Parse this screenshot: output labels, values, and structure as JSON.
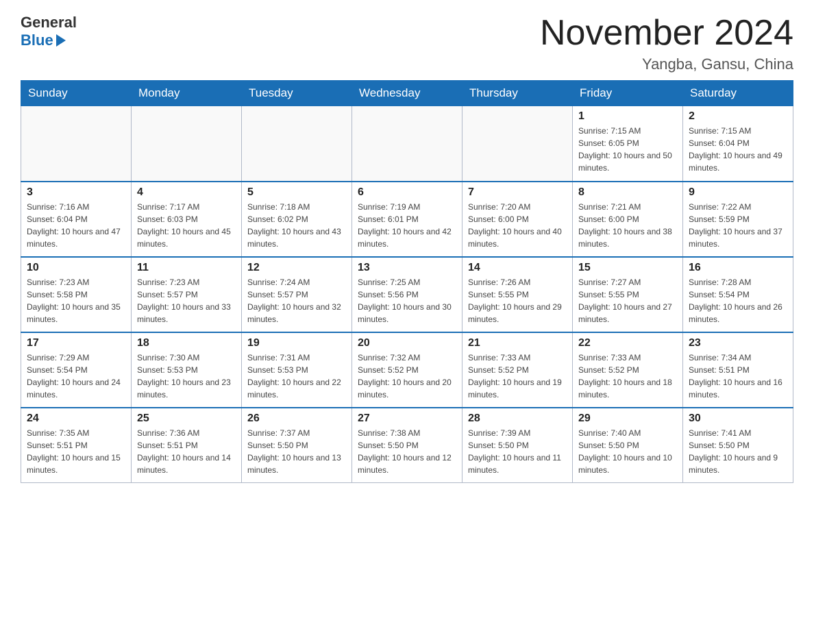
{
  "header": {
    "logo_general": "General",
    "logo_blue": "Blue",
    "month_title": "November 2024",
    "location": "Yangba, Gansu, China"
  },
  "days_of_week": [
    "Sunday",
    "Monday",
    "Tuesday",
    "Wednesday",
    "Thursday",
    "Friday",
    "Saturday"
  ],
  "weeks": [
    [
      {
        "day": "",
        "info": ""
      },
      {
        "day": "",
        "info": ""
      },
      {
        "day": "",
        "info": ""
      },
      {
        "day": "",
        "info": ""
      },
      {
        "day": "",
        "info": ""
      },
      {
        "day": "1",
        "info": "Sunrise: 7:15 AM\nSunset: 6:05 PM\nDaylight: 10 hours and 50 minutes."
      },
      {
        "day": "2",
        "info": "Sunrise: 7:15 AM\nSunset: 6:04 PM\nDaylight: 10 hours and 49 minutes."
      }
    ],
    [
      {
        "day": "3",
        "info": "Sunrise: 7:16 AM\nSunset: 6:04 PM\nDaylight: 10 hours and 47 minutes."
      },
      {
        "day": "4",
        "info": "Sunrise: 7:17 AM\nSunset: 6:03 PM\nDaylight: 10 hours and 45 minutes."
      },
      {
        "day": "5",
        "info": "Sunrise: 7:18 AM\nSunset: 6:02 PM\nDaylight: 10 hours and 43 minutes."
      },
      {
        "day": "6",
        "info": "Sunrise: 7:19 AM\nSunset: 6:01 PM\nDaylight: 10 hours and 42 minutes."
      },
      {
        "day": "7",
        "info": "Sunrise: 7:20 AM\nSunset: 6:00 PM\nDaylight: 10 hours and 40 minutes."
      },
      {
        "day": "8",
        "info": "Sunrise: 7:21 AM\nSunset: 6:00 PM\nDaylight: 10 hours and 38 minutes."
      },
      {
        "day": "9",
        "info": "Sunrise: 7:22 AM\nSunset: 5:59 PM\nDaylight: 10 hours and 37 minutes."
      }
    ],
    [
      {
        "day": "10",
        "info": "Sunrise: 7:23 AM\nSunset: 5:58 PM\nDaylight: 10 hours and 35 minutes."
      },
      {
        "day": "11",
        "info": "Sunrise: 7:23 AM\nSunset: 5:57 PM\nDaylight: 10 hours and 33 minutes."
      },
      {
        "day": "12",
        "info": "Sunrise: 7:24 AM\nSunset: 5:57 PM\nDaylight: 10 hours and 32 minutes."
      },
      {
        "day": "13",
        "info": "Sunrise: 7:25 AM\nSunset: 5:56 PM\nDaylight: 10 hours and 30 minutes."
      },
      {
        "day": "14",
        "info": "Sunrise: 7:26 AM\nSunset: 5:55 PM\nDaylight: 10 hours and 29 minutes."
      },
      {
        "day": "15",
        "info": "Sunrise: 7:27 AM\nSunset: 5:55 PM\nDaylight: 10 hours and 27 minutes."
      },
      {
        "day": "16",
        "info": "Sunrise: 7:28 AM\nSunset: 5:54 PM\nDaylight: 10 hours and 26 minutes."
      }
    ],
    [
      {
        "day": "17",
        "info": "Sunrise: 7:29 AM\nSunset: 5:54 PM\nDaylight: 10 hours and 24 minutes."
      },
      {
        "day": "18",
        "info": "Sunrise: 7:30 AM\nSunset: 5:53 PM\nDaylight: 10 hours and 23 minutes."
      },
      {
        "day": "19",
        "info": "Sunrise: 7:31 AM\nSunset: 5:53 PM\nDaylight: 10 hours and 22 minutes."
      },
      {
        "day": "20",
        "info": "Sunrise: 7:32 AM\nSunset: 5:52 PM\nDaylight: 10 hours and 20 minutes."
      },
      {
        "day": "21",
        "info": "Sunrise: 7:33 AM\nSunset: 5:52 PM\nDaylight: 10 hours and 19 minutes."
      },
      {
        "day": "22",
        "info": "Sunrise: 7:33 AM\nSunset: 5:52 PM\nDaylight: 10 hours and 18 minutes."
      },
      {
        "day": "23",
        "info": "Sunrise: 7:34 AM\nSunset: 5:51 PM\nDaylight: 10 hours and 16 minutes."
      }
    ],
    [
      {
        "day": "24",
        "info": "Sunrise: 7:35 AM\nSunset: 5:51 PM\nDaylight: 10 hours and 15 minutes."
      },
      {
        "day": "25",
        "info": "Sunrise: 7:36 AM\nSunset: 5:51 PM\nDaylight: 10 hours and 14 minutes."
      },
      {
        "day": "26",
        "info": "Sunrise: 7:37 AM\nSunset: 5:50 PM\nDaylight: 10 hours and 13 minutes."
      },
      {
        "day": "27",
        "info": "Sunrise: 7:38 AM\nSunset: 5:50 PM\nDaylight: 10 hours and 12 minutes."
      },
      {
        "day": "28",
        "info": "Sunrise: 7:39 AM\nSunset: 5:50 PM\nDaylight: 10 hours and 11 minutes."
      },
      {
        "day": "29",
        "info": "Sunrise: 7:40 AM\nSunset: 5:50 PM\nDaylight: 10 hours and 10 minutes."
      },
      {
        "day": "30",
        "info": "Sunrise: 7:41 AM\nSunset: 5:50 PM\nDaylight: 10 hours and 9 minutes."
      }
    ]
  ]
}
